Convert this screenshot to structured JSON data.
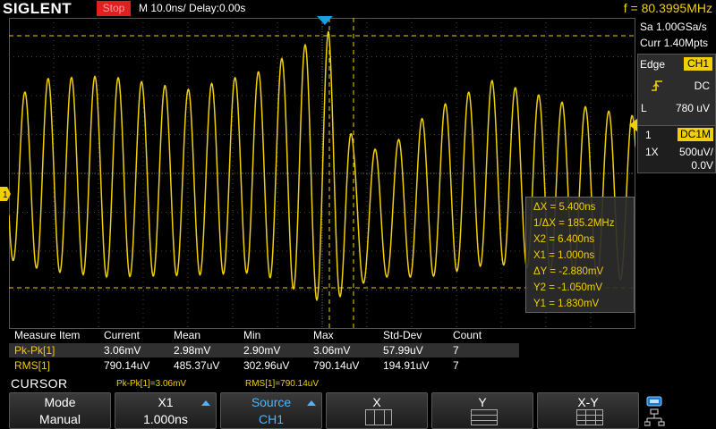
{
  "header": {
    "brand": "SIGLENT",
    "run_state": "Stop",
    "timebase": "M 10.0ns/  Delay:0.00s",
    "frequency": "f = 80.3995MHz"
  },
  "acquisition": {
    "sample_rate": "Sa 1.00GSa/s",
    "memory_depth": "Curr 1.40Mpts"
  },
  "trigger": {
    "type": "Edge",
    "source": "CH1",
    "coupling": "DC",
    "level_label": "L",
    "level": "780 uV",
    "slope_icon": "rising-edge-icon"
  },
  "channel": {
    "number": "1",
    "coupling_impedance": "DC1M",
    "probe": "1X",
    "scale": "500uV/",
    "offset": "0.0V",
    "marker": "1",
    "color": "#f0d000"
  },
  "cursor_readout": [
    "ΔX = 5.400ns",
    "1/ΔX = 185.2MHz",
    "X2 = 6.400ns",
    "X1 = 1.000ns",
    "ΔY = -2.880mV",
    "Y2 = -1.050mV",
    "Y1 = 1.830mV"
  ],
  "measure": {
    "headers": [
      "Measure Item",
      "Current",
      "Mean",
      "Min",
      "Max",
      "Std-Dev",
      "Count"
    ],
    "rows": [
      [
        "Pk-Pk[1]",
        "3.06mV",
        "2.98mV",
        "2.90mV",
        "3.06mV",
        "57.99uV",
        "7"
      ],
      [
        "RMS[1]",
        "790.14uV",
        "485.37uV",
        "302.96uV",
        "790.14uV",
        "194.91uV",
        "7"
      ]
    ]
  },
  "menu": {
    "title": "CURSOR",
    "summary_1": "Pk-Pk[1]=3.06mV",
    "summary_2": "RMS[1]=790.14uV"
  },
  "softkeys": [
    {
      "line1": "Mode",
      "line2": "Manual"
    },
    {
      "line1": "X1",
      "line2": "1.000ns"
    },
    {
      "line1": "Source",
      "line2": "CH1"
    },
    {
      "line1": "X",
      "line2": ""
    },
    {
      "line1": "Y",
      "line2": ""
    },
    {
      "line1": "X-Y",
      "line2": ""
    }
  ],
  "colors": {
    "trace": "#f0d000",
    "stop": "#e02020",
    "trigger_marker": "#1aa0e0",
    "accent": "#4ab4ff"
  },
  "icons": [
    "trigger-position-icon",
    "trigger-level-icon",
    "channel-marker-icon",
    "usb-icon",
    "network-icon"
  ]
}
